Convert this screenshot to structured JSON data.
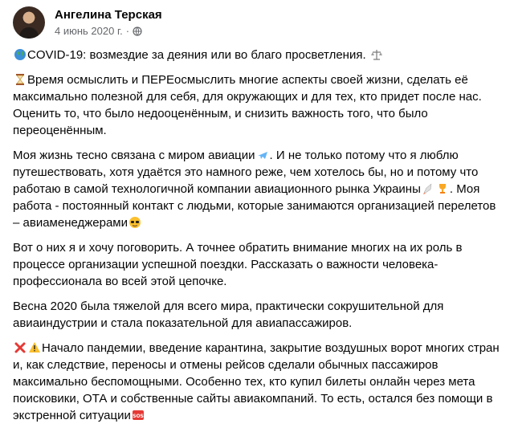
{
  "post": {
    "author": "Ангелина Терская",
    "date": "4 июнь 2020 г.",
    "separator": "·",
    "privacy_icon": "globe-icon",
    "paragraphs": [
      {
        "icon_before": "globe-emoji",
        "text": "COVID-19: возмездие за деяния или во благо просветления.",
        "icon_after": "balance-scale-emoji"
      },
      {
        "icon_before": "hourglass-emoji",
        "text": "Время осмыслить и ПЕРЕосмыслить многие аспекты своей жизни, сделать её максимально полезной для себя, для окружающих и для тех, кто придет после нас. Оценить то, что было недооценённым, и снизить важность того, что было переоценённым."
      },
      {
        "parts": [
          "Моя жизнь тесно связана с миром авиации",
          ". И не только потому что я люблю путешествовать, хотя удаётся это намного реже, чем хотелось бы, но и потому что работаю в самой технологичной компании авиационного рынка Украины",
          ". Моя работа - постоянный контакт с людьми, которые занимаются организацией перелетов – авиаменеджерами"
        ],
        "icons": [
          "airplane-emoji",
          "rocket-emoji",
          "trophy-emoji",
          "sunglasses-emoji"
        ]
      },
      {
        "text": "Вот о них я и хочу поговорить. А точнее обратить внимание многих на их роль в процессе организации успешной поездки. Рассказать о важности человека-профессионала во всей этой цепочке."
      },
      {
        "text": "Весна 2020 была тяжелой для всего мира, практически сокрушительной для авиаиндустрии и стала показательной для авиапассажиров."
      },
      {
        "icons_before": [
          "cross-mark-emoji",
          "warning-emoji"
        ],
        "text": "Начало пандемии, введение карантина, закрытие воздушных ворот многих стран и, как следствие, переносы и отмены рейсов сделали обычных пассажиров максимально беспомощными. Особенно тех, кто купил билеты онлайн через мета поисковики, ОТА и собственные сайты авиакомпаний. То есть, остался без помощи в экстренной ситуации",
        "icon_after": "sos-emoji"
      }
    ]
  }
}
